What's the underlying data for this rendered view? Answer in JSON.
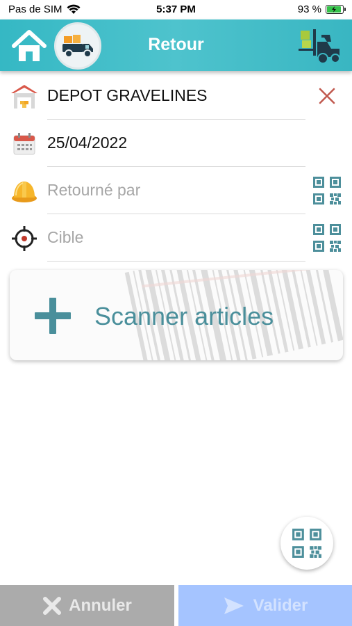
{
  "status_bar": {
    "carrier": "Pas de SIM",
    "time": "5:37 PM",
    "battery": "93 %"
  },
  "header": {
    "title": "Retour",
    "home_icon": "home-icon",
    "truck_icon": "truck-icon",
    "forklift_icon": "forklift-icon",
    "color": "#35b8c4"
  },
  "form": {
    "depot": {
      "value": "DEPOT GRAVELINES",
      "icon": "warehouse-icon",
      "action_icon": "close-icon"
    },
    "date": {
      "value": "25/04/2022",
      "icon": "calendar-icon"
    },
    "returned_by": {
      "placeholder": "Retourné par",
      "icon": "hard-hat-icon",
      "action_icon": "qr-code-icon"
    },
    "target": {
      "placeholder": "Cible",
      "icon": "crosshair-icon",
      "action_icon": "qr-code-icon"
    }
  },
  "scan": {
    "label": "Scanner articles",
    "icon": "plus-icon"
  },
  "actions": {
    "cancel_label": "Annuler",
    "validate_label": "Valider",
    "cancel_color": "#ababab",
    "validate_color": "#a5c4ff"
  }
}
